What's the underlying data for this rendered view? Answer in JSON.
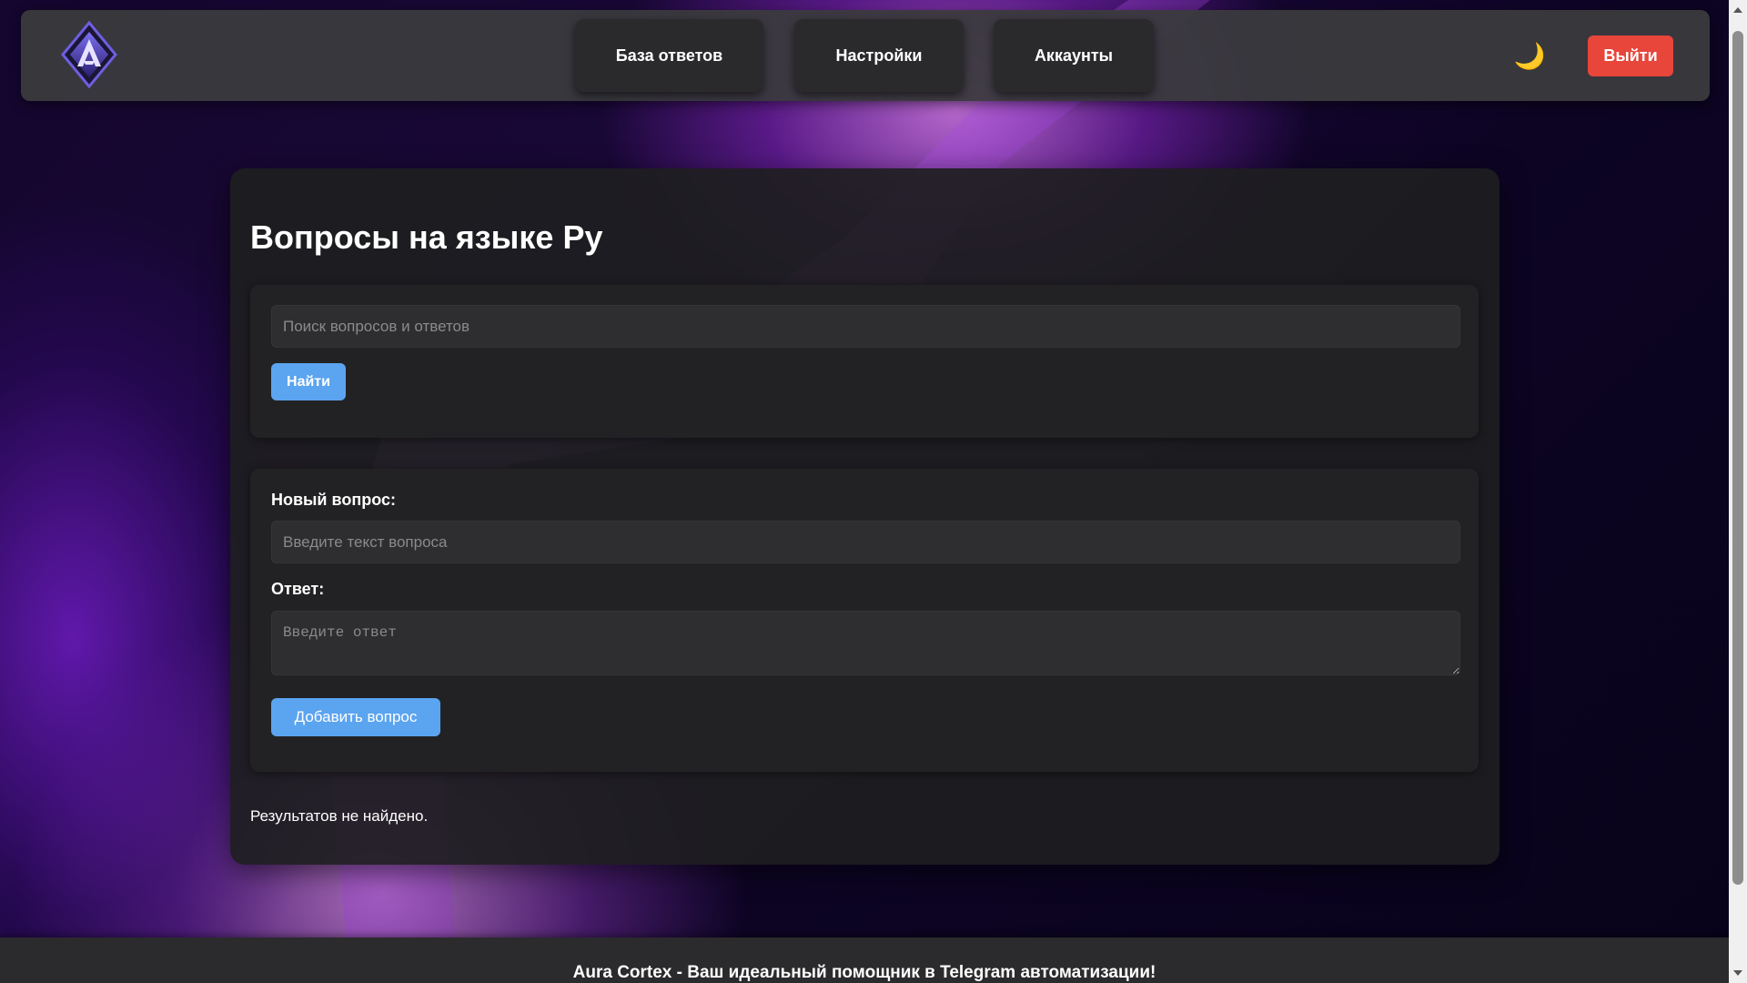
{
  "header": {
    "logo_icon": "aura-cortex-logo-icon",
    "nav": [
      {
        "label": "База ответов"
      },
      {
        "label": "Настройки"
      },
      {
        "label": "Аккаунты"
      }
    ],
    "theme_toggle_icon": "moon-icon",
    "theme_toggle_glyph": "🌙",
    "logout_label": "Выйти"
  },
  "main": {
    "title": "Вопросы на языке Ру",
    "search": {
      "placeholder": "Поиск вопросов и ответов",
      "value": "",
      "button_label": "Найти"
    },
    "add_form": {
      "question_label": "Новый вопрос:",
      "question_placeholder": "Введите текст вопроса",
      "answer_label": "Ответ:",
      "answer_placeholder": "Введите ответ",
      "submit_label": "Добавить вопрос"
    },
    "results_text": "Результатов не найдено."
  },
  "footer": {
    "brand": "Aura Cortex",
    "tagline": " - Ваш идеальный помощник в Telegram автоматизации!"
  },
  "colors": {
    "accent_blue": "#5ba4f0",
    "logout_red": "#e8453b",
    "panel": "#222224",
    "card": "#1e1e20"
  }
}
